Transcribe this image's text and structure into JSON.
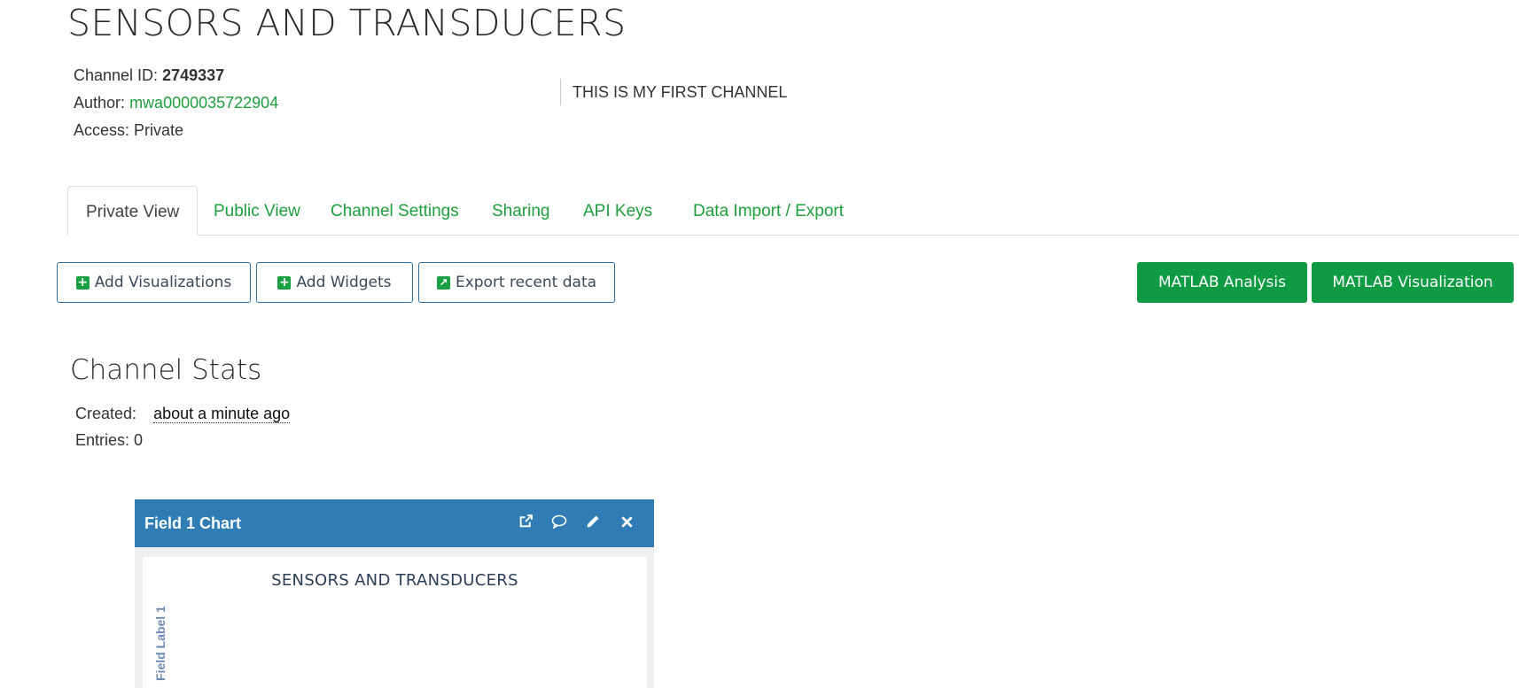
{
  "channel": {
    "title": "SENSORS AND TRANSDUCERS",
    "id_label": "Channel ID:",
    "id_value": "2749337",
    "author_label": "Author:",
    "author_value": "mwa0000035722904",
    "access_label": "Access:",
    "access_value": "Private",
    "description": "THIS IS MY FIRST CHANNEL"
  },
  "tabs": [
    {
      "label": "Private View",
      "active": true
    },
    {
      "label": "Public View"
    },
    {
      "label": "Channel Settings"
    },
    {
      "label": "Sharing"
    },
    {
      "label": "API Keys"
    },
    {
      "label": "Data Import / Export"
    }
  ],
  "toolbar": {
    "add_visualizations": "Add Visualizations",
    "add_widgets": "Add Widgets",
    "export_recent": "Export recent data",
    "matlab_analysis": "MATLAB Analysis",
    "matlab_visualization": "MATLAB Visualization"
  },
  "stats": {
    "heading": "Channel Stats",
    "created_label": "Created:",
    "created_value": "about a minute ago",
    "entries_label": "Entries:",
    "entries_value": "0"
  },
  "chart_card": {
    "header": "Field 1 Chart",
    "icons": [
      "external-link-icon",
      "comment-icon",
      "pencil-icon",
      "close-icon"
    ]
  },
  "chart_data": {
    "type": "line",
    "title": "SENSORS AND TRANSDUCERS",
    "xlabel": "",
    "ylabel": "Field Label 1",
    "series": []
  },
  "colors": {
    "link_green": "#1e9e3c",
    "button_green": "#0f9a44",
    "card_header_blue": "#2f7db4"
  }
}
